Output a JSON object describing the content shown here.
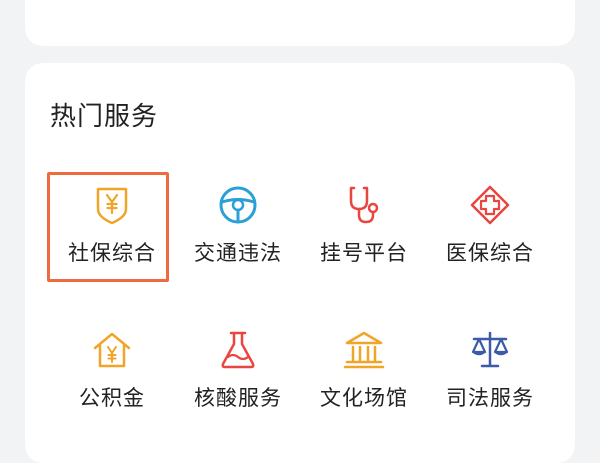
{
  "section": {
    "title": "热门服务"
  },
  "services": [
    {
      "label": "社保综合",
      "icon": "social-security-icon",
      "color": "#f0a526"
    },
    {
      "label": "交通违法",
      "icon": "steering-wheel-icon",
      "color": "#2a9fd8"
    },
    {
      "label": "挂号平台",
      "icon": "stethoscope-icon",
      "color": "#e8463f"
    },
    {
      "label": "医保综合",
      "icon": "medical-cross-icon",
      "color": "#e8463f"
    },
    {
      "label": "公积金",
      "icon": "housing-fund-icon",
      "color": "#f0a526"
    },
    {
      "label": "核酸服务",
      "icon": "flask-icon",
      "color": "#e8463f"
    },
    {
      "label": "文化场馆",
      "icon": "museum-icon",
      "color": "#f0a526"
    },
    {
      "label": "司法服务",
      "icon": "scales-icon",
      "color": "#3b5aa8"
    }
  ],
  "highlight_color": "#f06a3f"
}
